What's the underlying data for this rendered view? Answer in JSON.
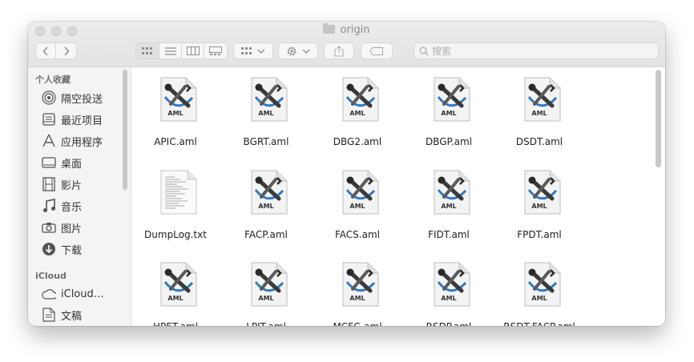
{
  "window": {
    "title": "origin"
  },
  "toolbar": {
    "search_placeholder": "搜索"
  },
  "sidebar": {
    "sections": [
      {
        "header": "个人收藏",
        "items": [
          {
            "label": "隔空投送",
            "icon": "airdrop-icon"
          },
          {
            "label": "最近项目",
            "icon": "recents-icon"
          },
          {
            "label": "应用程序",
            "icon": "applications-icon"
          },
          {
            "label": "桌面",
            "icon": "desktop-icon"
          },
          {
            "label": "影片",
            "icon": "movies-icon"
          },
          {
            "label": "音乐",
            "icon": "music-icon"
          },
          {
            "label": "图片",
            "icon": "pictures-icon"
          },
          {
            "label": "下载",
            "icon": "downloads-icon"
          }
        ]
      },
      {
        "header": "iCloud",
        "items": [
          {
            "label": "iCloud…",
            "icon": "cloud-icon"
          },
          {
            "label": "文稿",
            "icon": "documents-icon"
          }
        ]
      }
    ]
  },
  "files": [
    {
      "name": "APIC.aml",
      "type": "aml"
    },
    {
      "name": "BGRT.aml",
      "type": "aml"
    },
    {
      "name": "DBG2.aml",
      "type": "aml"
    },
    {
      "name": "DBGP.aml",
      "type": "aml"
    },
    {
      "name": "DSDT.aml",
      "type": "aml"
    },
    {
      "name": "DumpLog.txt",
      "type": "txt"
    },
    {
      "name": "FACP.aml",
      "type": "aml"
    },
    {
      "name": "FACS.aml",
      "type": "aml"
    },
    {
      "name": "FIDT.aml",
      "type": "aml"
    },
    {
      "name": "FPDT.aml",
      "type": "aml"
    },
    {
      "name": "HPET.aml",
      "type": "aml"
    },
    {
      "name": "LPIT.aml",
      "type": "aml"
    },
    {
      "name": "MCFG.aml",
      "type": "aml"
    },
    {
      "name": "RSDP.aml",
      "type": "aml"
    },
    {
      "name": "RSDT-FACP.aml",
      "type": "aml"
    }
  ],
  "file_icon_caption": "AML"
}
